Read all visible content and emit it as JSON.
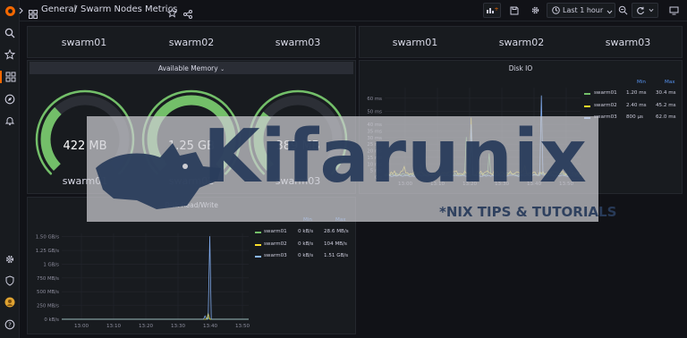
{
  "breadcrumb": {
    "folder": "General",
    "separator": "/",
    "dashboard": "Swarm Nodes Metrics"
  },
  "toolbar": {
    "time_range": "Last 1 hour"
  },
  "top_left_row": {
    "names": [
      "swarm01",
      "swarm02",
      "swarm03"
    ]
  },
  "top_right_row": {
    "names": [
      "swarm01",
      "swarm02",
      "swarm03"
    ]
  },
  "memory_panel": {
    "title": "Available Memory",
    "gauges": [
      {
        "value": "422 MB",
        "name": "swarm01",
        "fill": 0.34
      },
      {
        "value": "1.25 GB",
        "name": "swarm02",
        "fill": 1.0
      },
      {
        "value": "389 MB",
        "name": "swarm03",
        "fill": 0.31
      }
    ],
    "gauge_color": "#73bf69"
  },
  "diskio_panel": {
    "title": "Disk IO",
    "legend_headers": {
      "min": "Min",
      "max": "Max"
    },
    "legend": [
      {
        "name": "swarm01",
        "min": "1.20 ms",
        "max": "30.4 ms",
        "color": "#73bf69"
      },
      {
        "name": "swarm02",
        "min": "2.40 ms",
        "max": "45.2 ms",
        "color": "#fade2a"
      },
      {
        "name": "swarm03",
        "min": "800 µs",
        "max": "62.0 ms",
        "color": "#8ab8ff"
      }
    ]
  },
  "diskrw_panel": {
    "title": "Disk Read/Write",
    "legend_headers": {
      "min": "Min",
      "max": "Max"
    },
    "legend": [
      {
        "name": "swarm01",
        "min": "0 kB/s",
        "max": "28.6 MB/s",
        "color": "#73bf69"
      },
      {
        "name": "swarm02",
        "min": "0 kB/s",
        "max": "104 MB/s",
        "color": "#fade2a"
      },
      {
        "name": "swarm03",
        "min": "0 kB/s",
        "max": "1.51 GB/s",
        "color": "#8ab8ff"
      }
    ]
  },
  "chart_data": [
    {
      "type": "line",
      "title": "Disk IO",
      "y_ticks": [
        "0 s",
        "5 ms",
        "10 ms",
        "15 ms",
        "20 ms",
        "25 ms",
        "30 ms",
        "35 ms",
        "40 ms",
        "50 ms",
        "60 ms"
      ],
      "y_tick_values": [
        0,
        5,
        10,
        15,
        20,
        25,
        30,
        35,
        40,
        50,
        60
      ],
      "x_ticks": [
        "13:00",
        "13:10",
        "13:20",
        "13:30",
        "13:40",
        "13:50"
      ],
      "ylim": [
        0,
        68
      ],
      "series": [
        {
          "name": "swarm01",
          "min": 1.2,
          "max": 30.4,
          "baseline": 2,
          "spikes": [
            [
              0.42,
              30.4
            ],
            [
              0.53,
              18
            ],
            [
              0.18,
              10
            ]
          ]
        },
        {
          "name": "swarm02",
          "min": 2.4,
          "max": 45.2,
          "baseline": 3,
          "spikes": [
            [
              0.1,
              8
            ],
            [
              0.44,
              45.2
            ],
            [
              0.72,
              9
            ]
          ]
        },
        {
          "name": "swarm03",
          "min": 0.8,
          "max": 62.0,
          "baseline": 1,
          "spikes": [
            [
              0.8,
              62.0
            ],
            [
              0.44,
              40
            ],
            [
              0.95,
              12
            ]
          ]
        }
      ]
    },
    {
      "type": "line",
      "title": "Disk Read/Write",
      "y_ticks": [
        "0 kB/s",
        "250 MB/s",
        "500 MB/s",
        "750 MB/s",
        "1 GB/s",
        "1.25 GB/s",
        "1.50 GB/s"
      ],
      "y_tick_values": [
        0,
        250,
        500,
        750,
        1000,
        1250,
        1500
      ],
      "x_ticks": [
        "13:00",
        "13:10",
        "13:20",
        "13:30",
        "13:40",
        "13:50"
      ],
      "ylim": [
        0,
        1560
      ],
      "series": [
        {
          "name": "swarm01",
          "min": 0,
          "max": 28.6,
          "spikes": [
            [
              0.78,
              28.6
            ]
          ]
        },
        {
          "name": "swarm02",
          "min": 0,
          "max": 104,
          "spikes": [
            [
              0.78,
              104
            ]
          ]
        },
        {
          "name": "swarm03",
          "min": 0,
          "max": 1510,
          "spikes": [
            [
              0.79,
              1510
            ],
            [
              0.77,
              60
            ]
          ]
        }
      ]
    }
  ],
  "watermark": {
    "brand": "Kifarunix",
    "tagline": "*NIX TIPS & TUTORIALS"
  }
}
